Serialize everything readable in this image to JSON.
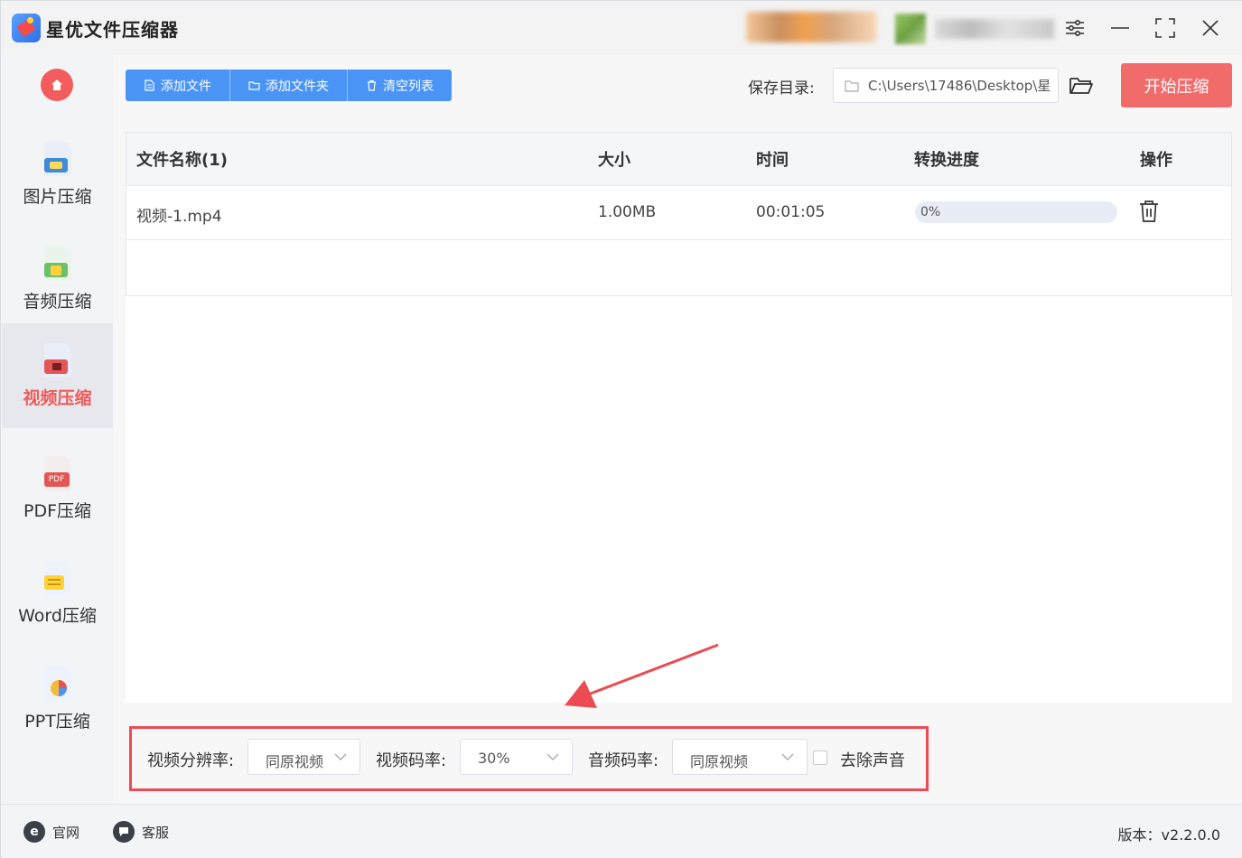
{
  "app": {
    "title": "星优文件压缩器"
  },
  "sidebar": {
    "items": [
      {
        "label": "图片压缩",
        "icon": "image-icon"
      },
      {
        "label": "音频压缩",
        "icon": "music-icon"
      },
      {
        "label": "视频压缩",
        "icon": "video-icon",
        "active": true
      },
      {
        "label": "PDF压缩",
        "icon": "pdf-icon",
        "tag": "PDF"
      },
      {
        "label": "Word压缩",
        "icon": "word-icon"
      },
      {
        "label": "PPT压缩",
        "icon": "ppt-icon"
      }
    ]
  },
  "toolbar": {
    "add_file": "添加文件",
    "add_folder": "添加文件夹",
    "clear_list": "清空列表",
    "save_dir_label": "保存目录:",
    "save_dir_value": "C:\\Users\\17486\\Desktop\\星",
    "start_label": "开始压缩"
  },
  "table": {
    "headers": [
      "文件名称(1)",
      "大小",
      "时间",
      "转换进度",
      "操作"
    ],
    "rows": [
      {
        "name": "视频-1.mp4",
        "size": "1.00MB",
        "time": "00:01:05",
        "progress_text": "0%",
        "progress": 0
      }
    ]
  },
  "settings": {
    "resolution_label": "视频分辨率:",
    "resolution_value": "同原视频",
    "video_bitrate_label": "视频码率:",
    "video_bitrate_value": "30%",
    "audio_bitrate_label": "音频码率:",
    "audio_bitrate_value": "同原视频",
    "remove_audio_label": "去除声音",
    "remove_audio_checked": false
  },
  "statusbar": {
    "website": "官网",
    "support": "客服",
    "version": "版本：v2.2.0.0"
  },
  "colors": {
    "accent_blue": "#4a94f5",
    "accent_red": "#f26b6b",
    "highlight_red": "#ec4b53"
  }
}
